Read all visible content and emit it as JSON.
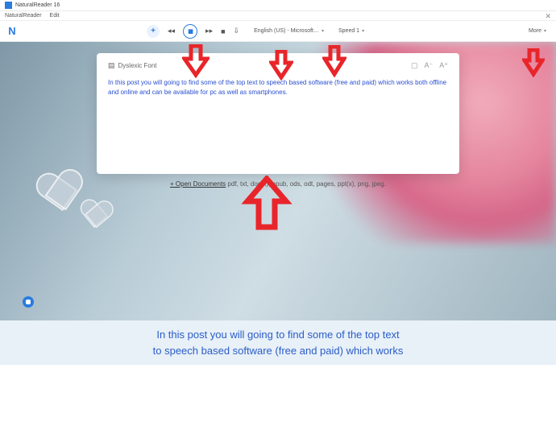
{
  "window": {
    "title": "NaturalReader 16"
  },
  "menu": {
    "item1": "NaturalReader",
    "item2": "Edit"
  },
  "toolbar": {
    "brand": "N",
    "add": "+",
    "rewind": "◂◂",
    "pause": "▮▮",
    "forward": "▸▸",
    "stop": "■",
    "download": "⇩",
    "voice": "English (US) - Microsoft…",
    "speed": "Speed 1",
    "more": "More"
  },
  "panel": {
    "title": "Dyslexic Font",
    "body": "In this post you will going to find some of the top text to speech based software (free and paid) which works both offline and online and can be available for pc as well as smartphones."
  },
  "open_docs": {
    "link": "+ Open Documents",
    "formats": " pdf, txt, doc(x), epub, ods, odt, pages, ppt(x), png, jpeg."
  },
  "caption": {
    "line1": "In this post you will going to find some of the top text",
    "line2": "to speech based software (free and paid) which works"
  }
}
